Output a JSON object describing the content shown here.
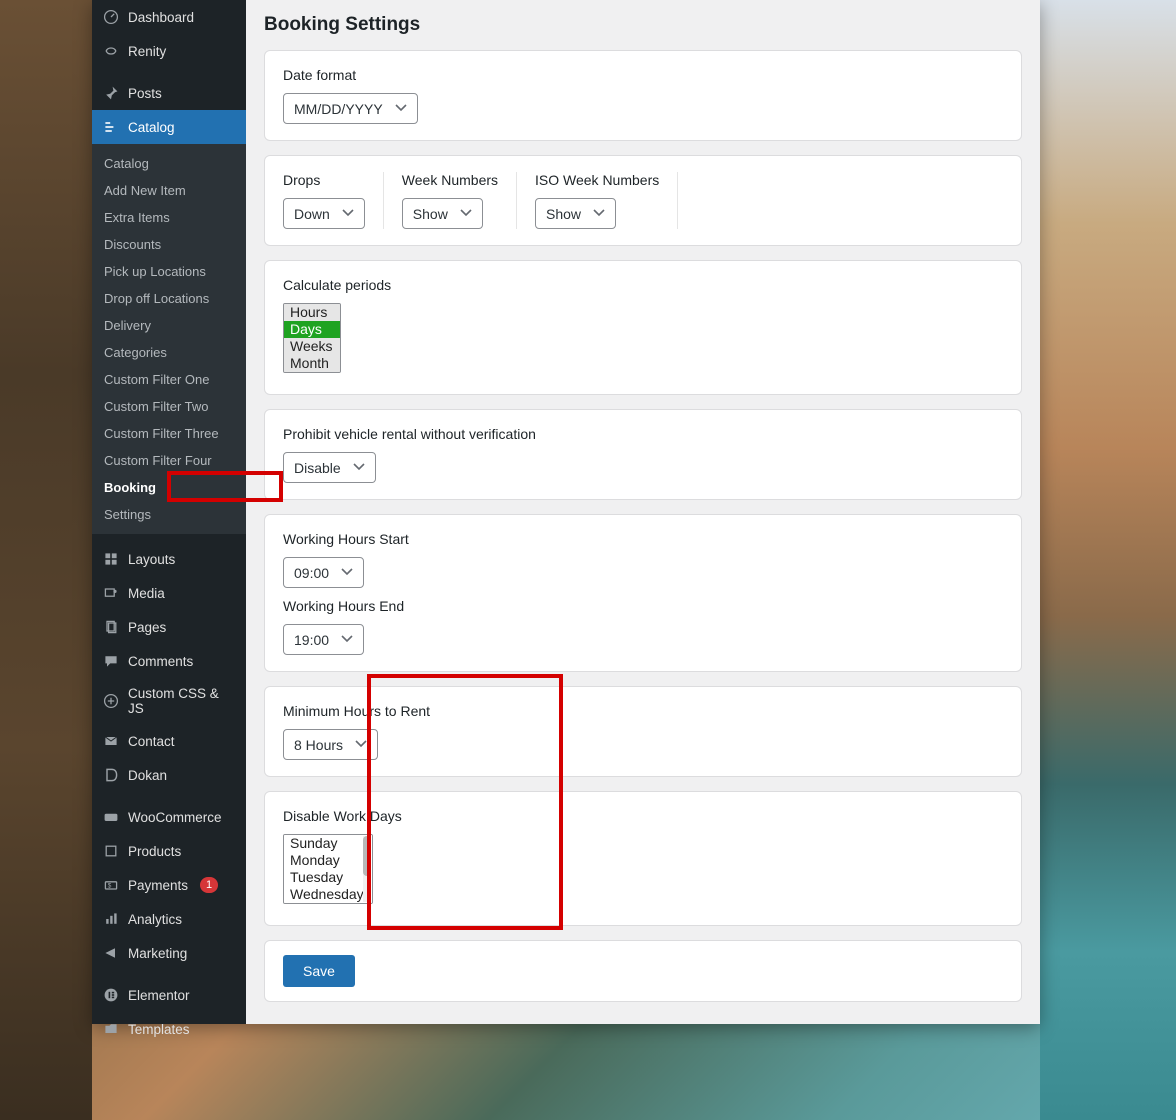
{
  "page": {
    "title": "Booking Settings"
  },
  "sidebar": {
    "main": [
      {
        "label": "Dashboard",
        "icon": "dashboard"
      },
      {
        "label": "Renity",
        "icon": "renity"
      },
      {
        "label": "Posts",
        "icon": "pin"
      },
      {
        "label": "Catalog",
        "icon": "catalog",
        "active": true
      },
      {
        "label": "Layouts",
        "icon": "layouts"
      },
      {
        "label": "Media",
        "icon": "media"
      },
      {
        "label": "Pages",
        "icon": "pages"
      },
      {
        "label": "Comments",
        "icon": "comments"
      },
      {
        "label": "Custom CSS & JS",
        "icon": "plus-circle"
      },
      {
        "label": "Contact",
        "icon": "mail"
      },
      {
        "label": "Dokan",
        "icon": "dokan"
      },
      {
        "label": "WooCommerce",
        "icon": "woo"
      },
      {
        "label": "Products",
        "icon": "products"
      },
      {
        "label": "Payments",
        "icon": "payments",
        "badge": "1"
      },
      {
        "label": "Analytics",
        "icon": "analytics"
      },
      {
        "label": "Marketing",
        "icon": "marketing"
      },
      {
        "label": "Elementor",
        "icon": "elementor"
      },
      {
        "label": "Templates",
        "icon": "templates"
      }
    ],
    "sub": [
      "Catalog",
      "Add New Item",
      "Extra Items",
      "Discounts",
      "Pick up Locations",
      "Drop off Locations",
      "Delivery",
      "Categories",
      "Custom Filter One",
      "Custom Filter Two",
      "Custom Filter Three",
      "Custom Filter Four",
      "Booking",
      "Settings"
    ],
    "sub_current": "Booking"
  },
  "settings": {
    "date_format": {
      "label": "Date format",
      "value": "MM/DD/YYYY"
    },
    "drops": {
      "label": "Drops",
      "value": "Down"
    },
    "week_numbers": {
      "label": "Week Numbers",
      "value": "Show"
    },
    "iso_week_numbers": {
      "label": "ISO Week Numbers",
      "value": "Show"
    },
    "calculate_periods": {
      "label": "Calculate periods",
      "options": [
        "Hours",
        "Days",
        "Weeks",
        "Month"
      ],
      "selected": "Days"
    },
    "prohibit": {
      "label": "Prohibit vehicle rental without verification",
      "value": "Disable"
    },
    "hours_start": {
      "label": "Working Hours Start",
      "value": "09:00"
    },
    "hours_end": {
      "label": "Working Hours End",
      "value": "19:00"
    },
    "min_hours": {
      "label": "Minimum Hours to Rent",
      "value": "8 Hours"
    },
    "disable_days": {
      "label": "Disable Work Days",
      "options": [
        "Sunday",
        "Monday",
        "Tuesday",
        "Wednesday"
      ]
    }
  },
  "actions": {
    "save": "Save"
  }
}
